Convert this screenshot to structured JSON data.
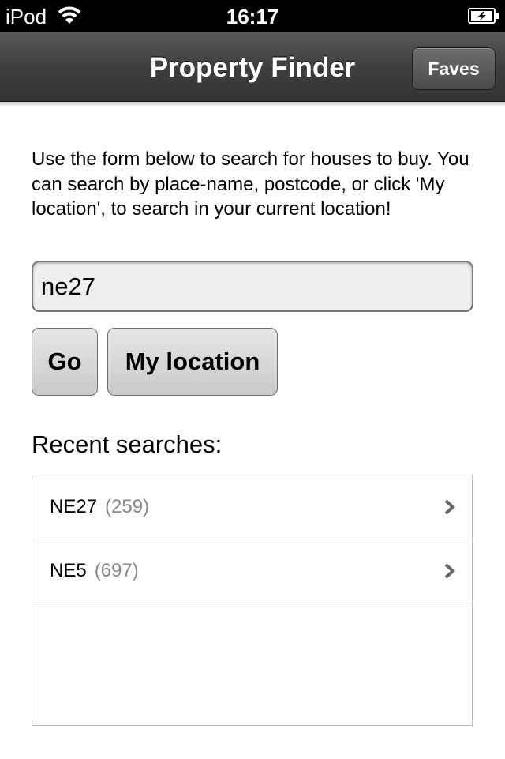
{
  "status_bar": {
    "carrier": "iPod",
    "time": "16:17",
    "wifi_icon": "wifi-icon",
    "battery_icon": "battery-charging-icon"
  },
  "nav_bar": {
    "title": "Property Finder",
    "faves_label": "Faves"
  },
  "intro_text": "Use the form below to search for houses to buy. You can search by place-name, postcode, or click 'My location', to search in your current location!",
  "search": {
    "value": "ne27"
  },
  "buttons": {
    "go_label": "Go",
    "my_location_label": "My location"
  },
  "recent": {
    "title": "Recent searches:",
    "items": [
      {
        "name": "NE27",
        "count": "(259)"
      },
      {
        "name": "NE5",
        "count": "(697)"
      }
    ]
  },
  "colors": {
    "nav_bar": "#3f3f3f",
    "button": "#d6d6d6",
    "count_text": "#888888"
  }
}
